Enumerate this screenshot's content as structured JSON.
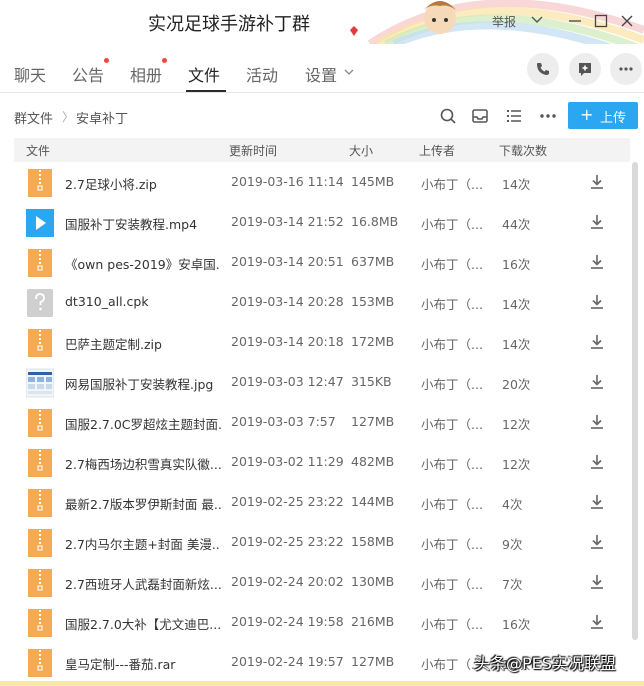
{
  "window": {
    "title": "实况足球手游补丁群",
    "report_label": "举报"
  },
  "tabs": [
    {
      "label": "聊天",
      "active": false,
      "badge": false
    },
    {
      "label": "公告",
      "active": false,
      "badge": true
    },
    {
      "label": "相册",
      "active": false,
      "badge": true
    },
    {
      "label": "文件",
      "active": true,
      "badge": false
    },
    {
      "label": "活动",
      "active": false,
      "badge": false
    },
    {
      "label": "设置",
      "active": false,
      "badge": false
    }
  ],
  "breadcrumb": {
    "root": "群文件",
    "current": "安卓补丁"
  },
  "toolbar": {
    "upload_label": "上传"
  },
  "table": {
    "columns": [
      "文件",
      "更新时间",
      "大小",
      "上传者",
      "下载次数"
    ],
    "rows": [
      {
        "icon": "zip-file-icon",
        "name": "2.7足球小将.zip",
        "date": "2019-03-16 11:14",
        "size": "145MB",
        "uploader": "小布丁（...",
        "downloads": "14次"
      },
      {
        "icon": "video-file-icon",
        "name": "国服补丁安装教程.mp4",
        "date": "2019-03-14 21:52",
        "size": "16.8MB",
        "uploader": "小布丁（...",
        "downloads": "44次"
      },
      {
        "icon": "zip-file-icon",
        "name": "《own pes-2019》安卓国...",
        "date": "2019-03-14 20:51",
        "size": "637MB",
        "uploader": "小布丁（...",
        "downloads": "16次"
      },
      {
        "icon": "unknown-file-icon",
        "name": "dt310_all.cpk",
        "date": "2019-03-14 20:28",
        "size": "153MB",
        "uploader": "小布丁（...",
        "downloads": "14次"
      },
      {
        "icon": "zip-file-icon",
        "name": "巴萨主题定制.zip",
        "date": "2019-03-14 20:18",
        "size": "172MB",
        "uploader": "小布丁（...",
        "downloads": "14次"
      },
      {
        "icon": "image-thumbnail-icon",
        "name": "网易国服补丁安装教程.jpg",
        "date": "2019-03-03 12:47",
        "size": "315KB",
        "uploader": "小布丁（...",
        "downloads": "20次"
      },
      {
        "icon": "zip-file-icon",
        "name": "国服2.7.0C罗超炫主题封面...",
        "date": "2019-03-03 7:57",
        "size": "127MB",
        "uploader": "小布丁（...",
        "downloads": "12次"
      },
      {
        "icon": "zip-file-icon",
        "name": "2.7梅西场边积雪真实队徽...",
        "date": "2019-03-02 11:29",
        "size": "482MB",
        "uploader": "小布丁（...",
        "downloads": "12次"
      },
      {
        "icon": "zip-file-icon",
        "name": "最新2.7版本罗伊斯封面 最...",
        "date": "2019-02-25 23:22",
        "size": "144MB",
        "uploader": "小布丁（...",
        "downloads": "4次"
      },
      {
        "icon": "zip-file-icon",
        "name": "2.7内马尔主题+封面 美漫...",
        "date": "2019-02-25 23:22",
        "size": "158MB",
        "uploader": "小布丁（...",
        "downloads": "9次"
      },
      {
        "icon": "zip-file-icon",
        "name": "2.7西班牙人武磊封面新炫...",
        "date": "2019-02-24 20:02",
        "size": "130MB",
        "uploader": "小布丁（...",
        "downloads": "7次"
      },
      {
        "icon": "zip-file-icon",
        "name": "国服2.7.0大补【尤文迪巴...",
        "date": "2019-02-24 19:58",
        "size": "216MB",
        "uploader": "小布丁（...",
        "downloads": "16次"
      },
      {
        "icon": "zip-file-icon",
        "name": "皇马定制---番茄.rar",
        "date": "2019-02-24 19:57",
        "size": "127MB",
        "uploader": "小布丁（...",
        "downloads": "12次"
      }
    ]
  },
  "watermark": "头条@PES实况联盟",
  "colors": {
    "accent": "#2ba6f0",
    "zip_icon": "#f5ab53",
    "video_icon": "#2ba6f0",
    "unknown_icon": "#cfcfcf",
    "badge": "#f0463c"
  }
}
